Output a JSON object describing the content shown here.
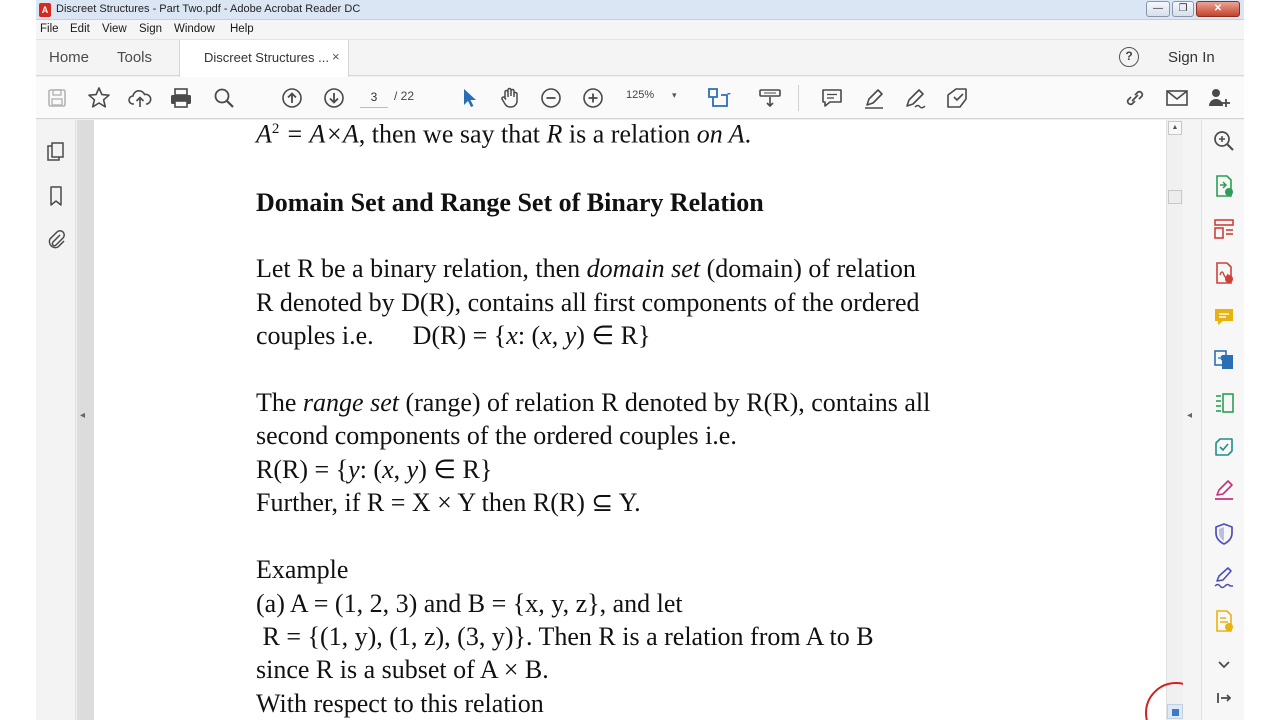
{
  "window": {
    "title": "Discreet Structures - Part Two.pdf - Adobe Acrobat Reader DC",
    "app_icon": "A",
    "minimize": "—",
    "maximize": "❐",
    "close": "✕"
  },
  "menu": [
    "File",
    "Edit",
    "View",
    "Sign",
    "Window",
    "Help"
  ],
  "tabs": {
    "home": "Home",
    "tools": "Tools",
    "document": "Discreet Structures ...",
    "close": "×"
  },
  "header": {
    "help": "?",
    "sign_in": "Sign In"
  },
  "toolbar": {
    "page_current": "3",
    "page_total": "/ 22",
    "zoom": "125%",
    "zoom_dropdown": "▾",
    "icons": [
      "save-icon",
      "star-icon",
      "cloud-upload-icon",
      "print-icon",
      "search-icon",
      "page-up-icon",
      "page-down-icon",
      "select-cursor-icon",
      "hand-icon",
      "zoom-out-icon",
      "zoom-in-icon",
      "fit-page-icon",
      "scroll-mode-icon",
      "comment-icon",
      "highlight-icon",
      "draw-icon",
      "stamp-icon",
      "share-link-icon",
      "email-icon",
      "add-user-icon"
    ]
  },
  "left_pane": {
    "icons": [
      "page-thumbnails-icon",
      "bookmark-icon",
      "attachment-icon"
    ],
    "collapse": "◂"
  },
  "right_pane": {
    "collapse": "◂",
    "icons": [
      "zoom-tool-icon",
      "export-pdf-icon",
      "organize-pages-icon",
      "create-pdf-icon",
      "comment-tool-icon",
      "combine-files-icon",
      "edit-pdf-icon",
      "send-for-review-icon",
      "fill-sign-icon",
      "protect-icon",
      "sign-icon",
      "more-tools-icon",
      "expand-more-icon",
      "collapse-pane-icon"
    ],
    "colors": {
      "blue": "#2a6fb5",
      "green": "#2f9d57",
      "red": "#d0403a",
      "yellow": "#e8b30e",
      "teal": "#1f8f8a",
      "magenta": "#c8317a",
      "indigo": "#4e4fb8"
    }
  },
  "scrollbar": {
    "up": "▲"
  },
  "document": {
    "line_top_pre": "A",
    "line_top_sup": "2",
    "line_top_mid": " = A×A",
    "line_top_after": ", then we say that ",
    "line_top_r": "R",
    "line_top_mid2": " is a relation ",
    "line_top_on": "on A",
    "line_top_end": ".",
    "heading": "Domain Set and Range Set of Binary Relation",
    "p1_l1_a": "Let R be a binary relation, then ",
    "p1_l1_i": "domain set",
    "p1_l1_b": " (domain) of relation",
    "p1_l2": "R denoted by D(R), contains all first components of the ordered",
    "p1_l3_a": "couples i.e.      D(R) = {",
    "p1_l3_x": "x",
    "p1_l3_b": ": (",
    "p1_l3_x2": "x",
    "p1_l3_c": ", ",
    "p1_l3_y": "y",
    "p1_l3_d": ") ∈ R}",
    "p2_l1_a": "The ",
    "p2_l1_i": "range set",
    "p2_l1_b": " (range) of relation R denoted by R(R), contains all",
    "p2_l2": "second components of the ordered couples i.e.",
    "p2_l3_a": "R(R) = {",
    "p2_l3_y": "y",
    "p2_l3_b": ": (",
    "p2_l3_x": "x",
    "p2_l3_c": ", ",
    "p2_l3_y2": "y",
    "p2_l3_d": ") ∈ R}",
    "p2_l4": "Further, if R = X × Y then R(R) ⊆ Y.",
    "ex_title": "Example",
    "ex_l1": "(a) A = (1, 2, 3) and B = {x, y, z}, and let",
    "ex_l2": " R = {(1, y), (1, z), (3, y)}. Then R is a relation from A to B",
    "ex_l3": "since R is a subset of A × B.",
    "ex_l4": "With respect to this relation"
  }
}
